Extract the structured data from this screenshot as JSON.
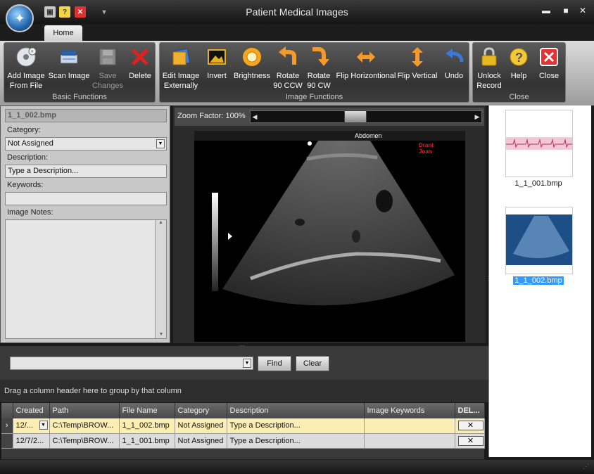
{
  "window": {
    "title": "Patient Medical Images",
    "qat": {
      "save_icon": "save-icon",
      "help_icon": "help-icon",
      "close_icon": "close-icon"
    },
    "controls": {
      "minimize": "▬",
      "maximize": "■",
      "close": "✕"
    }
  },
  "ribbon": {
    "tabs": [
      "Home"
    ],
    "groups": [
      {
        "label": "Basic Functions",
        "buttons": [
          {
            "label1": "Add Image",
            "label2": "From File",
            "icon": "disc-add-icon",
            "enabled": true
          },
          {
            "label1": "Scan Image",
            "label2": "",
            "icon": "scanner-icon",
            "enabled": true
          },
          {
            "label1": "Save",
            "label2": "Changes",
            "icon": "floppy-icon",
            "enabled": false
          },
          {
            "label1": "Delete",
            "label2": "",
            "icon": "red-x-icon",
            "enabled": true
          }
        ]
      },
      {
        "label": "Image Functions",
        "buttons": [
          {
            "label1": "Edit Image",
            "label2": "Externally",
            "icon": "edit-image-icon"
          },
          {
            "label1": "Invert",
            "label2": "",
            "icon": "invert-icon"
          },
          {
            "label1": "Brightness",
            "label2": "",
            "icon": "brightness-icon"
          },
          {
            "label1": "Rotate",
            "label2": "90 CCW",
            "icon": "rotate-ccw-icon"
          },
          {
            "label1": "Rotate",
            "label2": "90 CW",
            "icon": "rotate-cw-icon"
          },
          {
            "label1": "Flip Horizontional",
            "label2": "",
            "icon": "flip-horizontal-icon"
          },
          {
            "label1": "Flip Vertical",
            "label2": "",
            "icon": "flip-vertical-icon"
          },
          {
            "label1": "Undo",
            "label2": "",
            "icon": "undo-icon"
          }
        ]
      },
      {
        "label": "Close",
        "buttons": [
          {
            "label1": "Unlock",
            "label2": "Record",
            "icon": "padlock-icon"
          },
          {
            "label1": "Help",
            "label2": "",
            "icon": "help-icon"
          },
          {
            "label1": "Close",
            "label2": "",
            "icon": "close-icon"
          }
        ]
      }
    ]
  },
  "details": {
    "filename": "1_1_002.bmp",
    "category_label": "Category:",
    "category_value": "Not Assigned",
    "description_label": "Description:",
    "description_placeholder": "Type a Description...",
    "keywords_label": "Keywords:",
    "keywords_value": "",
    "notes_label": "Image Notes:"
  },
  "viewer": {
    "zoom_label": "Zoom Factor: 100%",
    "zoom_fraction": 0.45,
    "overlay_title": "Abdomen",
    "overlay_name1": "Drant",
    "overlay_name2": "Joan"
  },
  "thumbnails": [
    {
      "name": "1_1_001.bmp",
      "selected": false
    },
    {
      "name": "1_1_002.bmp",
      "selected": true
    }
  ],
  "search": {
    "find_label": "Find",
    "clear_label": "Clear",
    "value": ""
  },
  "grid": {
    "group_hint": "Drag a column header here to group by that column",
    "columns": [
      "Created",
      "Path",
      "File Name",
      "Category",
      "Description",
      "Image Keywords",
      "DEL..."
    ],
    "rows": [
      {
        "created": "12/...",
        "path": "C:\\Temp\\BROW...",
        "file": "1_1_002.bmp",
        "category": "Not Assigned",
        "description": "Type a Description...",
        "keywords": "",
        "del": "✕"
      },
      {
        "created": "12/7/2...",
        "path": "C:\\Temp\\BROW...",
        "file": "1_1_001.bmp",
        "category": "Not Assigned",
        "description": "Type a Description...",
        "keywords": "",
        "del": "✕"
      }
    ]
  },
  "colors": {
    "accent": "#3399ff",
    "selected_row": "#fbeeb2"
  }
}
